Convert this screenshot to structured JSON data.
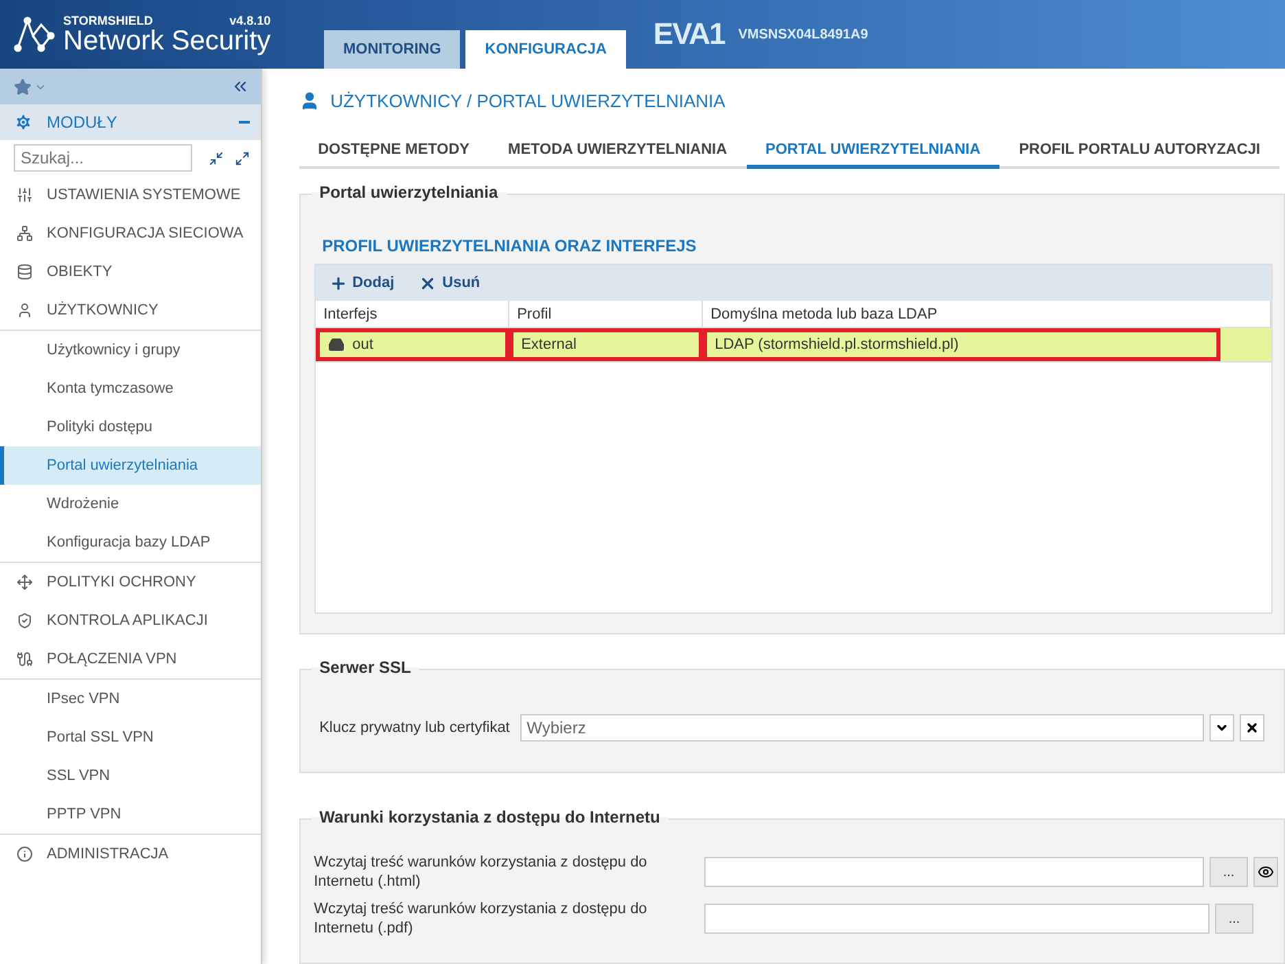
{
  "header": {
    "brand": "STORMSHIELD",
    "product": "Network Security",
    "version": "v4.8.10",
    "tabs": [
      {
        "label": "MONITORING",
        "selected": false
      },
      {
        "label": "KONFIGURACJA",
        "selected": true
      }
    ],
    "device_name": "EVA1",
    "serial": "VMSNSX04L8491A9"
  },
  "sidebar": {
    "modules_label": "MODUŁY",
    "search": {
      "placeholder": "Szukaj..."
    },
    "items": [
      {
        "label": "USTAWIENIA SYSTEMOWE"
      },
      {
        "label": "KONFIGURACJA SIECIOWA"
      },
      {
        "label": "OBIEKTY"
      },
      {
        "label": "UŻYTKOWNICY",
        "expanded": true,
        "children": [
          {
            "label": "Użytkownicy i grupy",
            "selected": false
          },
          {
            "label": "Konta tymczasowe",
            "selected": false
          },
          {
            "label": "Polityki dostępu",
            "selected": false
          },
          {
            "label": "Portal uwierzytelniania",
            "selected": true
          },
          {
            "label": "Wdrożenie",
            "selected": false
          },
          {
            "label": "Konfiguracja bazy LDAP",
            "selected": false
          }
        ]
      },
      {
        "label": "POLITYKI OCHRONY"
      },
      {
        "label": "KONTROLA APLIKACJI"
      },
      {
        "label": "POŁĄCZENIA VPN",
        "expanded": true,
        "children": [
          {
            "label": "IPsec VPN",
            "selected": false
          },
          {
            "label": "Portal SSL VPN",
            "selected": false
          },
          {
            "label": "SSL VPN",
            "selected": false
          },
          {
            "label": "PPTP VPN",
            "selected": false
          }
        ]
      },
      {
        "label": "ADMINISTRACJA"
      }
    ]
  },
  "page": {
    "breadcrumb": "UŻYTKOWNICY / PORTAL UWIERZYTELNIANIA",
    "tabs": [
      {
        "label": "DOSTĘPNE METODY",
        "selected": false
      },
      {
        "label": "METODA UWIERZYTELNIANIA",
        "selected": false
      },
      {
        "label": "PORTAL UWIERZYTELNIANIA",
        "selected": true
      },
      {
        "label": "PROFIL PORTALU AUTORYZACJI",
        "selected": false
      }
    ]
  },
  "portal_section": {
    "legend": "Portal uwierzytelniania",
    "heading": "PROFIL UWIERZYTELNIANIA ORAZ INTERFEJS",
    "toolbar": [
      "Dodaj",
      "Usuń"
    ],
    "columns": [
      "Interfejs",
      "Profil",
      "Domyślna metoda lub baza LDAP"
    ],
    "rows": [
      {
        "selected": true,
        "cells": [
          {
            "text": "out",
            "highlighted": true
          },
          {
            "text": "External",
            "highlighted": true
          },
          {
            "text": "LDAP (stormshield.pl.stormshield.pl)",
            "highlighted": true
          }
        ]
      }
    ]
  },
  "ssl_section": {
    "legend": "Serwer SSL",
    "field_label": "Klucz prywatny lub certyfikat",
    "select": {
      "placeholder": "Wybierz"
    }
  },
  "terms_section": {
    "legend": "Warunki korzystania z dostępu do Internetu",
    "rows": [
      {
        "label": "Wczytaj treść warunków korzystania z dostępu do Internetu (.html)",
        "browse": "...",
        "preview": true
      },
      {
        "label": "Wczytaj treść warunków korzystania z dostępu do Internetu (.pdf)",
        "browse": "..."
      }
    ]
  }
}
